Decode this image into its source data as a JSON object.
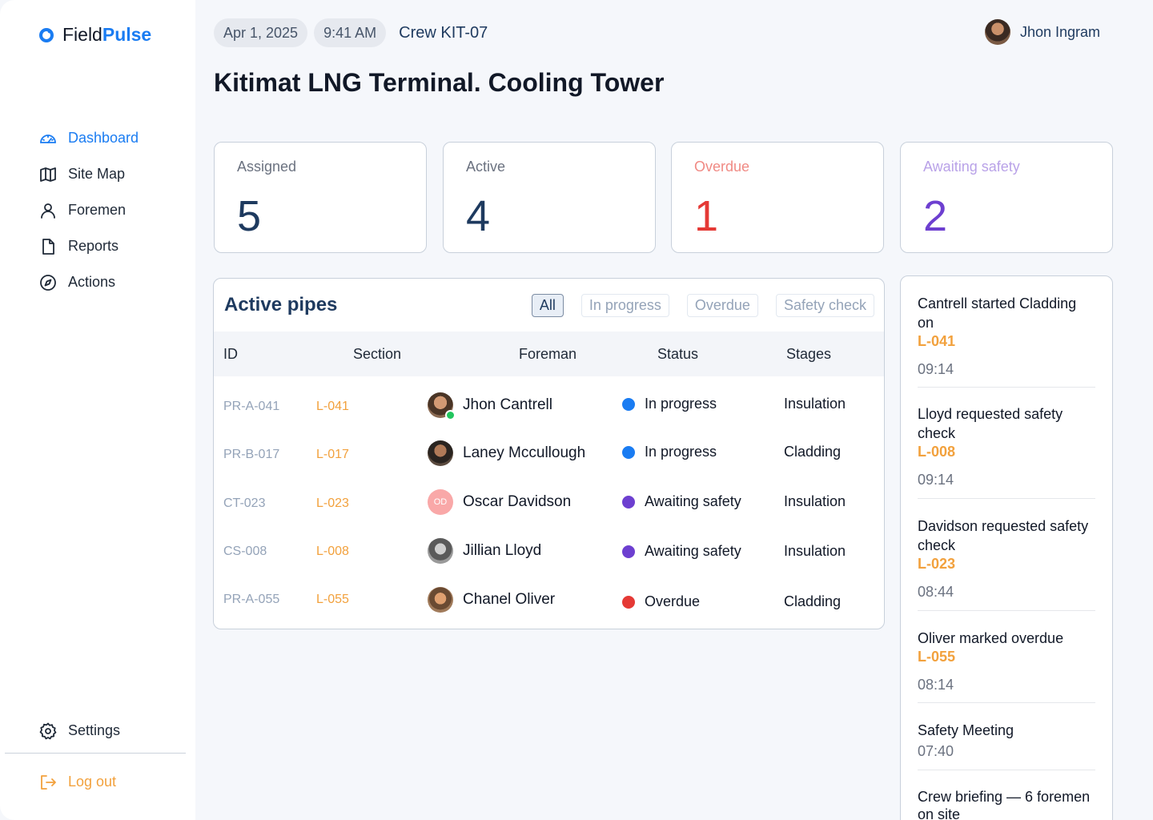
{
  "brand": {
    "name_a": "Field",
    "name_b": "Pulse"
  },
  "nav": {
    "items": [
      {
        "label": "Dashboard",
        "icon": "gauge-icon",
        "active": true
      },
      {
        "label": "Site Map",
        "icon": "map-icon"
      },
      {
        "label": "Foremen",
        "icon": "user-icon"
      },
      {
        "label": "Reports",
        "icon": "file-icon"
      },
      {
        "label": "Actions",
        "icon": "compass-icon"
      }
    ],
    "settings": "Settings",
    "logout": "Log out"
  },
  "topbar": {
    "date": "Apr 1, 2025",
    "time": "9:41 AM",
    "crew": "Crew KIT-07",
    "user": "Jhon Ingram"
  },
  "page_title": "Kitimat LNG Terminal. Cooling Tower",
  "stats": [
    {
      "label": "Assigned",
      "value": "5",
      "label_color": "#6b7280",
      "value_color": "#1e3a5f"
    },
    {
      "label": "Active",
      "value": "4",
      "label_color": "#6b7280",
      "value_color": "#1e3a5f"
    },
    {
      "label": "Overdue",
      "value": "1",
      "label_color": "#f08a84",
      "value_color": "#e53935"
    },
    {
      "label": "Awaiting safety",
      "value": "2",
      "label_color": "#b9a2e8",
      "value_color": "#6d3fd0"
    }
  ],
  "table": {
    "title": "Active pipes",
    "filters": [
      "All",
      "In progress",
      "Overdue",
      "Safety check"
    ],
    "columns": [
      "ID",
      "Section",
      "Foreman",
      "Status",
      "Stages"
    ],
    "rows": [
      {
        "id": "PR-A-041",
        "section": "L-041",
        "foreman": "Jhon Cantrell",
        "status": "In progress",
        "status_color": "#1a7cf2",
        "stage": "Insulation",
        "online": true
      },
      {
        "id": "PR-B-017",
        "section": "L-017",
        "foreman": "Laney Mccullough",
        "status": "In progress",
        "status_color": "#1a7cf2",
        "stage": "Cladding"
      },
      {
        "id": "CT-023",
        "section": "L-023",
        "foreman": "Oscar Davidson",
        "initials": "OD",
        "status": "Awaiting safety",
        "status_color": "#6d3fd0",
        "stage": "Insulation"
      },
      {
        "id": "CS-008",
        "section": "L-008",
        "foreman": "Jillian Lloyd",
        "status": "Awaiting safety",
        "status_color": "#6d3fd0",
        "stage": "Insulation"
      },
      {
        "id": "PR-A-055",
        "section": "L-055",
        "foreman": "Chanel Oliver",
        "status": "Overdue",
        "status_color": "#e53935",
        "stage": "Cladding"
      }
    ]
  },
  "feed": [
    {
      "text": "Cantrell started Cladding on",
      "code": "L-041",
      "time": "09:14"
    },
    {
      "text": "Lloyd requested safety check",
      "code": "L-008",
      "time": "09:14"
    },
    {
      "text": "Davidson requested safety check",
      "code": "L-023",
      "time": "08:44"
    },
    {
      "text": "Oliver marked overdue",
      "code": "L-055",
      "time": "08:14"
    },
    {
      "text": "Safety Meeting",
      "code": "",
      "time": "07:40"
    },
    {
      "text": "Crew briefing — 6 foremen on site",
      "code": "",
      "time": ""
    }
  ]
}
